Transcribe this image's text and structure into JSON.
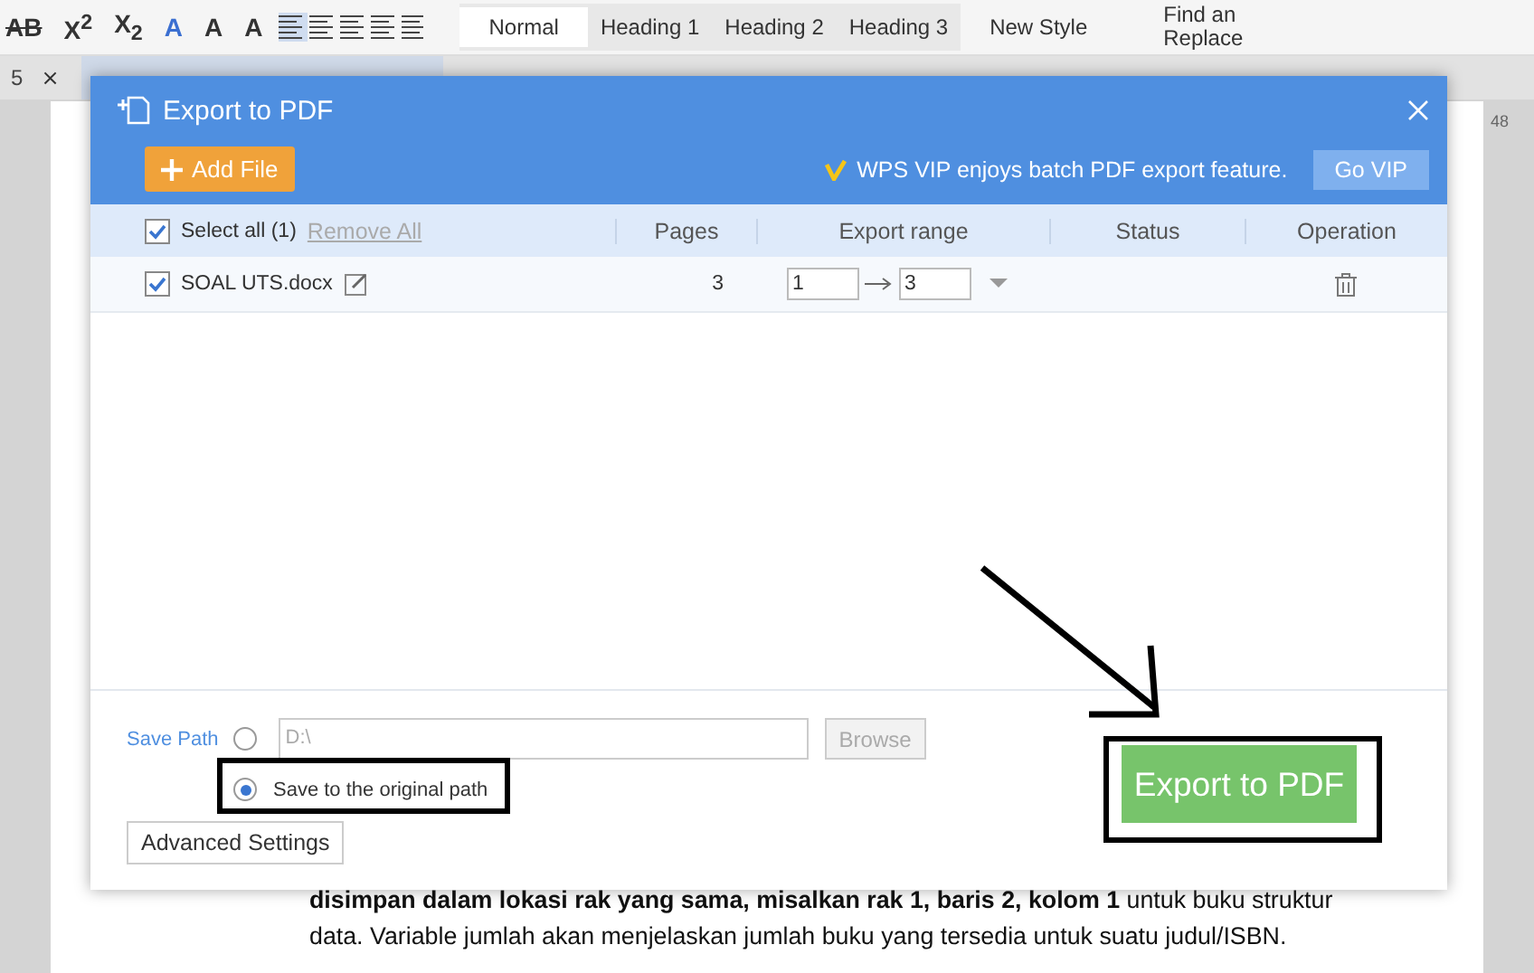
{
  "toolbar": {
    "format_buttons": [
      "AB",
      "X$^{2}$",
      "X$_{2}$",
      "A",
      "A",
      "A"
    ],
    "styles": [
      {
        "label": "Normal",
        "selected": true
      },
      {
        "label": "Heading 1",
        "selected": false
      },
      {
        "label": "Heading 2",
        "selected": false
      },
      {
        "label": "Heading 3",
        "selected": false
      }
    ],
    "new_style": "New Style",
    "find_replace": [
      "Find an",
      "Replace"
    ]
  },
  "tabs": [
    {
      "kind": "text",
      "label": "5",
      "close": "×",
      "selected": false
    },
    {
      "kind": "document",
      "selected": true
    }
  ],
  "ruler": "48",
  "dialog": {
    "title": "Export to PDF",
    "add_file": "Add File",
    "vip_message": "WPS VIP enjoys batch PDF export feature.",
    "go_vip": "Go VIP",
    "select_all": {
      "label": "Select all (1)",
      "checked": true
    },
    "remove_all": "Remove All",
    "columns": [
      "Pages",
      "Export range",
      "Status",
      "Operation"
    ],
    "rows": [
      {
        "name": "SOAL UTS.docx",
        "checked": true,
        "pages": "3",
        "range_from": "1",
        "range_to": "3"
      }
    ],
    "save_path": {
      "label": "Save Path",
      "options": [
        {
          "kind": "custom",
          "value": "D:\\",
          "selected": false
        },
        {
          "kind": "original",
          "label": "Save to the original path",
          "selected": true
        }
      ],
      "browse": {
        "label": "Browse",
        "disabled": true
      }
    },
    "advanced": "Advanced Settings",
    "export_button": "Export to PDF"
  },
  "document": {
    "lines": [
      "**disimpan dalam lokasi rak yang sama, misalkan  rak 1, baris 2, kolom 1**  untuk buku struktur",
      "data. Variable jumlah akan menjelaskan jumlah buku yang tersedia untuk suatu judul/ISBN."
    ]
  }
}
